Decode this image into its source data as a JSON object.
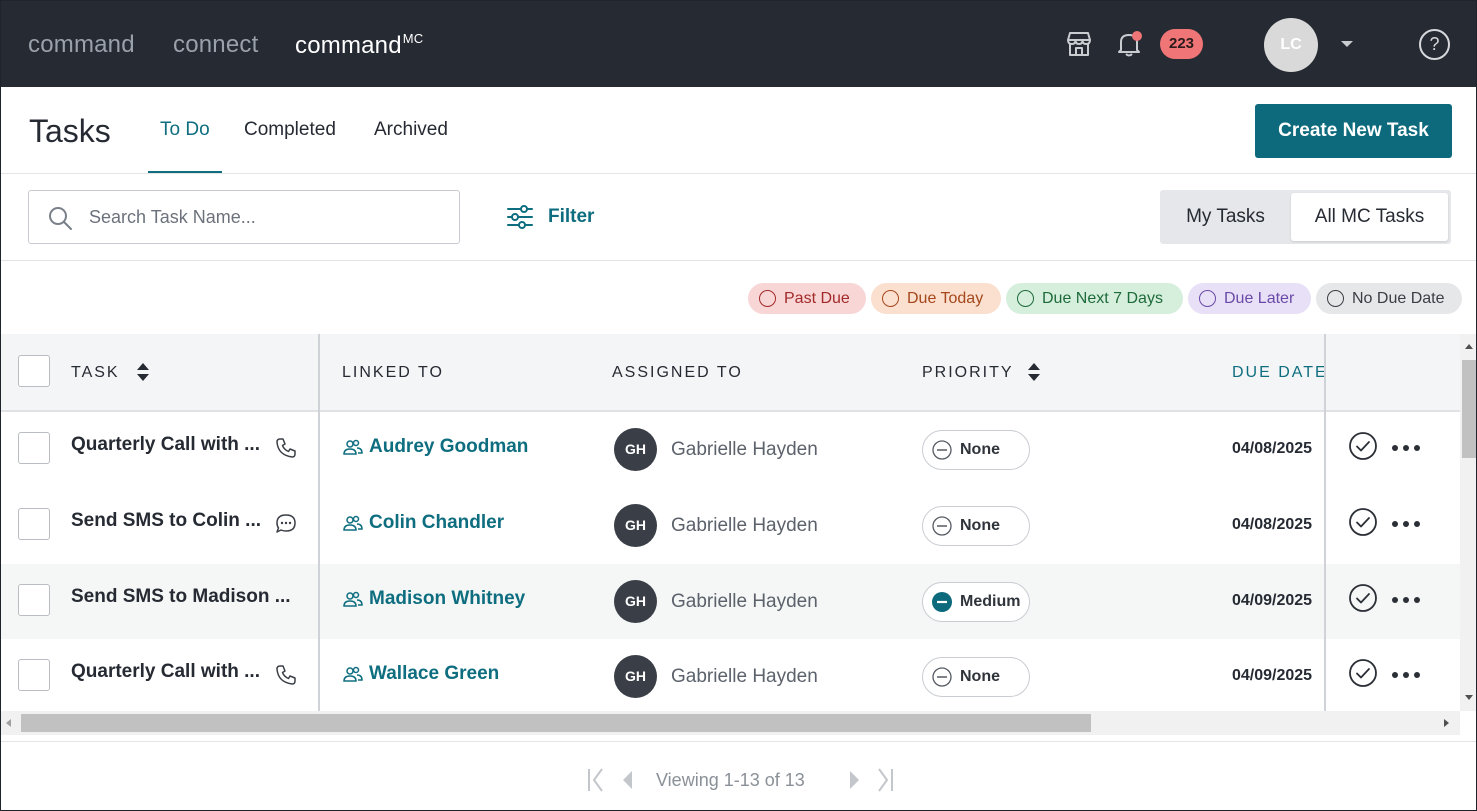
{
  "nav": {
    "brands": [
      {
        "label": "command"
      },
      {
        "label": "connect"
      },
      {
        "label": "command",
        "sup": "MC"
      }
    ],
    "notification_count": "223",
    "user_initials": "LC",
    "help_label": "?"
  },
  "header": {
    "title": "Tasks",
    "tabs": [
      {
        "label": "To Do",
        "active": true
      },
      {
        "label": "Completed",
        "active": false
      },
      {
        "label": "Archived",
        "active": false
      }
    ],
    "create_button": "Create New Task"
  },
  "toolbar": {
    "search_placeholder": "Search Task Name...",
    "search_value": "",
    "filter_label": "Filter",
    "scope_options": [
      {
        "label": "My Tasks",
        "selected": false
      },
      {
        "label": "All MC Tasks",
        "selected": true
      }
    ]
  },
  "legend": [
    {
      "label": "Past Due",
      "bg": "#f9d6d6",
      "fg": "#a32a2a"
    },
    {
      "label": "Due Today",
      "bg": "#fbe0cf",
      "fg": "#a4471c"
    },
    {
      "label": "Due Next 7 Days",
      "bg": "#d6efdd",
      "fg": "#1e6b3a"
    },
    {
      "label": "Due Later",
      "bg": "#e8e0f6",
      "fg": "#6a4aa8"
    },
    {
      "label": "No Due Date",
      "bg": "#e6e7e9",
      "fg": "#3a3e45"
    }
  ],
  "table": {
    "columns": [
      "TASK",
      "LINKED TO",
      "ASSIGNED TO",
      "PRIORITY",
      "DUE DATE"
    ],
    "rows": [
      {
        "task": "Quarterly Call with ...",
        "task_icon": "phone-icon",
        "linked_to": "Audrey Goodman",
        "assignee_initials": "GH",
        "assignee": "Gabrielle Hayden",
        "priority": "None",
        "due_date": "04/08/2025"
      },
      {
        "task": "Send SMS to Colin ...",
        "task_icon": "chat-bubble-icon",
        "linked_to": "Colin Chandler",
        "assignee_initials": "GH",
        "assignee": "Gabrielle Hayden",
        "priority": "None",
        "due_date": "04/08/2025"
      },
      {
        "task": "Send SMS to Madison ...",
        "task_icon": "",
        "linked_to": "Madison Whitney",
        "assignee_initials": "GH",
        "assignee": "Gabrielle Hayden",
        "priority": "Medium",
        "due_date": "04/09/2025"
      },
      {
        "task": "Quarterly Call with ...",
        "task_icon": "phone-icon",
        "linked_to": "Wallace Green",
        "assignee_initials": "GH",
        "assignee": "Gabrielle Hayden",
        "priority": "None",
        "due_date": "04/09/2025"
      }
    ]
  },
  "pagination": {
    "text": "Viewing 1-13 of 13"
  },
  "colors": {
    "accent": "#0c6a7c",
    "nav_bg": "#262a33",
    "badge": "#f07577"
  }
}
